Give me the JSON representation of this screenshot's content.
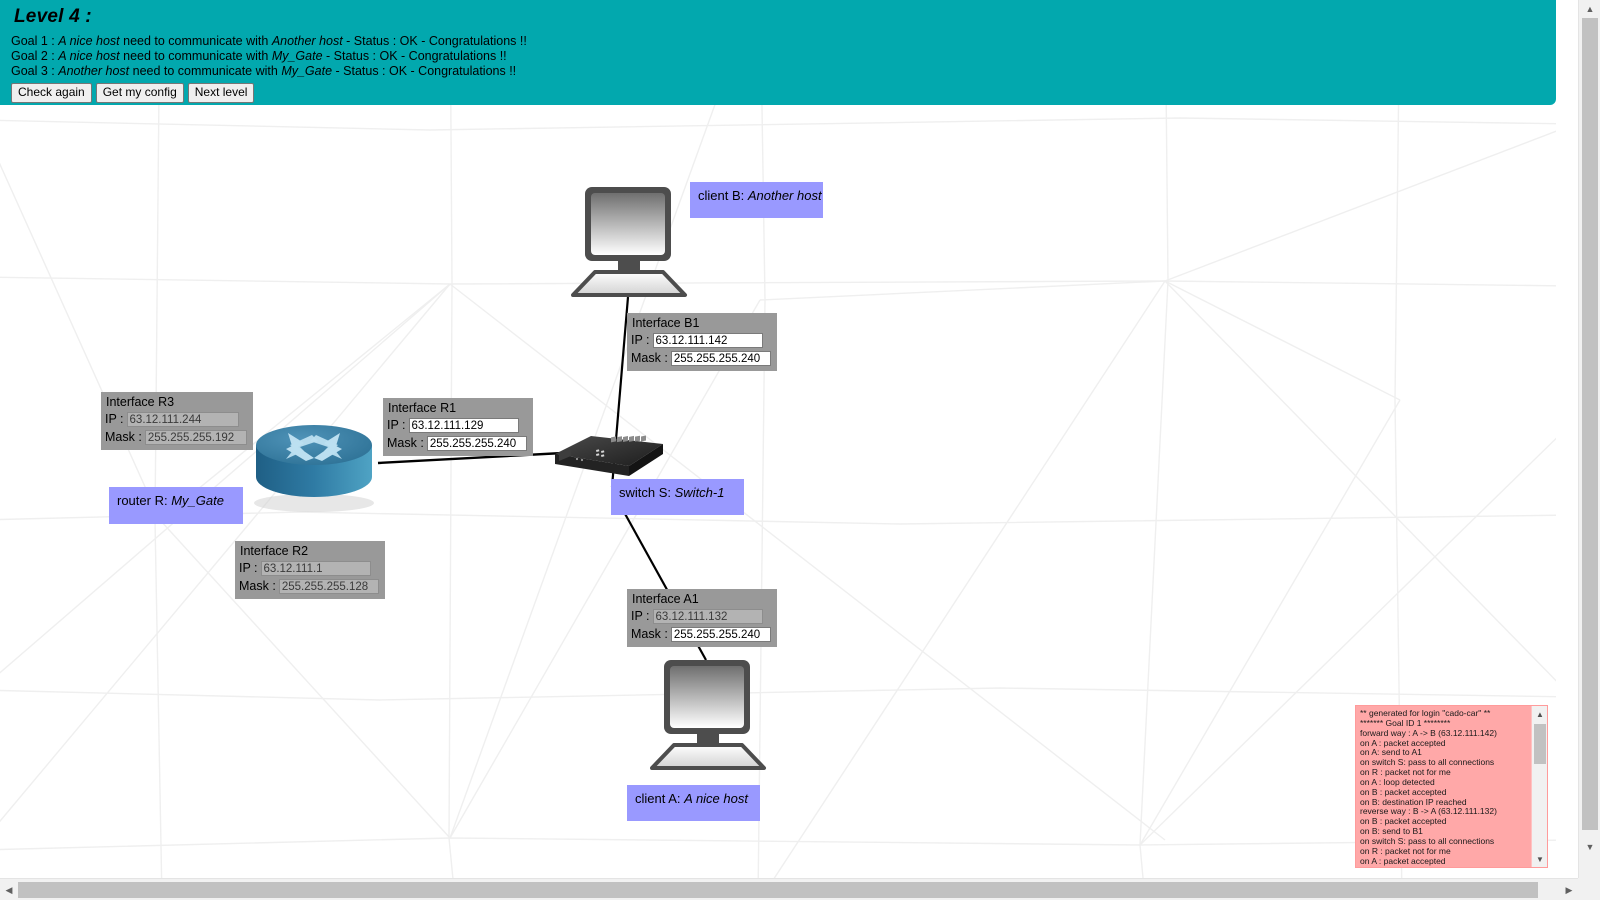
{
  "header": {
    "title": "Level 4 :",
    "goals": [
      {
        "prefix": "Goal 1 : ",
        "source": "A nice host",
        "mid": " need to communicate with ",
        "target": "Another host",
        "suffix": " - Status : OK - Congratulations !!"
      },
      {
        "prefix": "Goal 2 : ",
        "source": "A nice host",
        "mid": " need to communicate with ",
        "target": "My_Gate",
        "suffix": " - Status : OK - Congratulations !!"
      },
      {
        "prefix": "Goal 3 : ",
        "source": "Another host",
        "mid": " need to communicate with ",
        "target": "My_Gate",
        "suffix": " - Status : OK - Congratulations !!"
      }
    ],
    "buttons": [
      {
        "label": "Check again",
        "name": "check-again-button"
      },
      {
        "label": "Get my config",
        "name": "get-my-config-button"
      },
      {
        "label": "Next level",
        "name": "next-level-button"
      }
    ],
    "background_color": "#02A8AE"
  },
  "labels": {
    "client_b": {
      "prefix": "client B: ",
      "value": "Another host"
    },
    "client_a": {
      "prefix": "client A: ",
      "value": "A nice host"
    },
    "router_r": {
      "prefix": "router R: ",
      "value": "My_Gate"
    },
    "switch_s": {
      "prefix": "switch S: ",
      "value": "Switch-1"
    },
    "color": "#9999FF"
  },
  "interfaces": [
    {
      "id": "R3",
      "title": "Interface R3",
      "ip_label": "IP :",
      "ip_value": "63.12.111.244",
      "ip_readonly": true,
      "mask_label": "Mask :",
      "mask_value": "255.255.255.192",
      "mask_readonly": true
    },
    {
      "id": "R1",
      "title": "Interface R1",
      "ip_label": "IP :",
      "ip_value": "63.12.111.129",
      "ip_readonly": false,
      "mask_label": "Mask :",
      "mask_value": "255.255.255.240",
      "mask_readonly": false
    },
    {
      "id": "R2",
      "title": "Interface R2",
      "ip_label": "IP :",
      "ip_value": "63.12.111.1",
      "ip_readonly": true,
      "mask_label": "Mask :",
      "mask_value": "255.255.255.128",
      "mask_readonly": true
    },
    {
      "id": "B1",
      "title": "Interface B1",
      "ip_label": "IP :",
      "ip_value": "63.12.111.142",
      "ip_readonly": false,
      "mask_label": "Mask :",
      "mask_value": "255.255.255.240",
      "mask_readonly": false
    },
    {
      "id": "A1",
      "title": "Interface A1",
      "ip_label": "IP :",
      "ip_value": "63.12.111.132",
      "ip_readonly": true,
      "mask_label": "Mask :",
      "mask_value": "255.255.255.240",
      "mask_readonly": false
    }
  ],
  "log": {
    "background_color": "#FFA8A8",
    "lines": [
      "** generated for login \"cado-car\" **",
      "******* Goal ID 1 ********",
      "forward way : A -> B (63.12.111.142)",
      "on A : packet accepted",
      "on A: send to A1",
      "on switch S: pass to all connections",
      "on R : packet not for me",
      "on A : loop detected",
      "on B : packet accepted",
      "on B: destination IP reached",
      "reverse way : B -> A (63.12.111.132)",
      "on B : packet accepted",
      "on B: send to B1",
      "on switch S: pass to all connections",
      "on R : packet not for me",
      "on A : packet accepted"
    ]
  },
  "scrollbars": {
    "up_arrow": "▲",
    "down_arrow": "▼",
    "left_arrow": "◀",
    "right_arrow": "▶"
  }
}
